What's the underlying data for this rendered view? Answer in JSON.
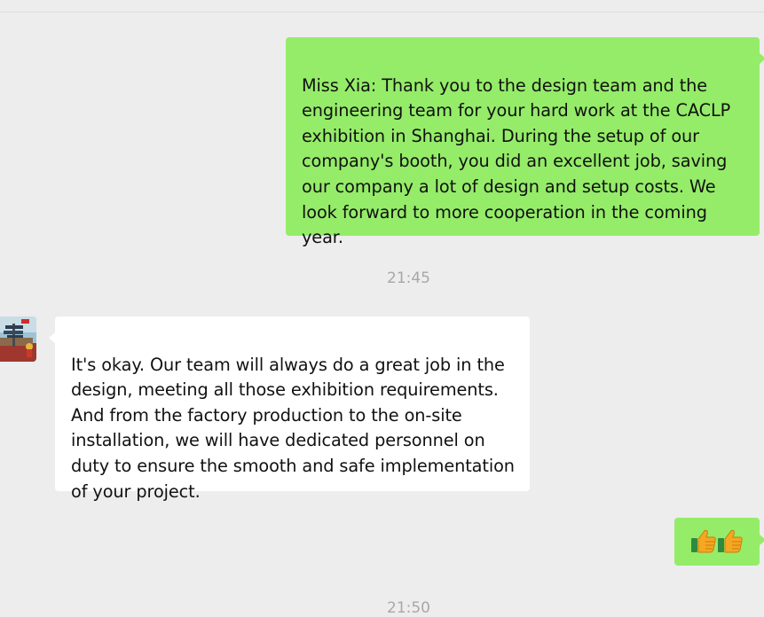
{
  "conversation": {
    "messages": [
      {
        "sender": "self",
        "text": "Miss Xia: Thank you to the design team and the engineering team for your hard work at the CACLP exhibition in Shanghai. During the setup of our company's booth, you did an excellent job, saving our company a lot of design and setup costs. We look forward to more cooperation in the coming year."
      },
      {
        "sender": "contact",
        "text": "It's okay. Our team will always do a great job in the design, meeting all those exhibition requirements. And from the factory production to the on-site installation, we will have dedicated personnel on duty to ensure the smooth and safe implementation of your project."
      },
      {
        "sender": "self",
        "emojis": [
          "thumbs-up-icon",
          "thumbs-up-icon"
        ]
      }
    ],
    "timestamps": [
      "21:45",
      "21:50"
    ]
  },
  "colors": {
    "background": "#ededed",
    "sent_bubble": "#95ec69",
    "received_bubble": "#ffffff",
    "timestamp_text": "#a8a8a8"
  }
}
